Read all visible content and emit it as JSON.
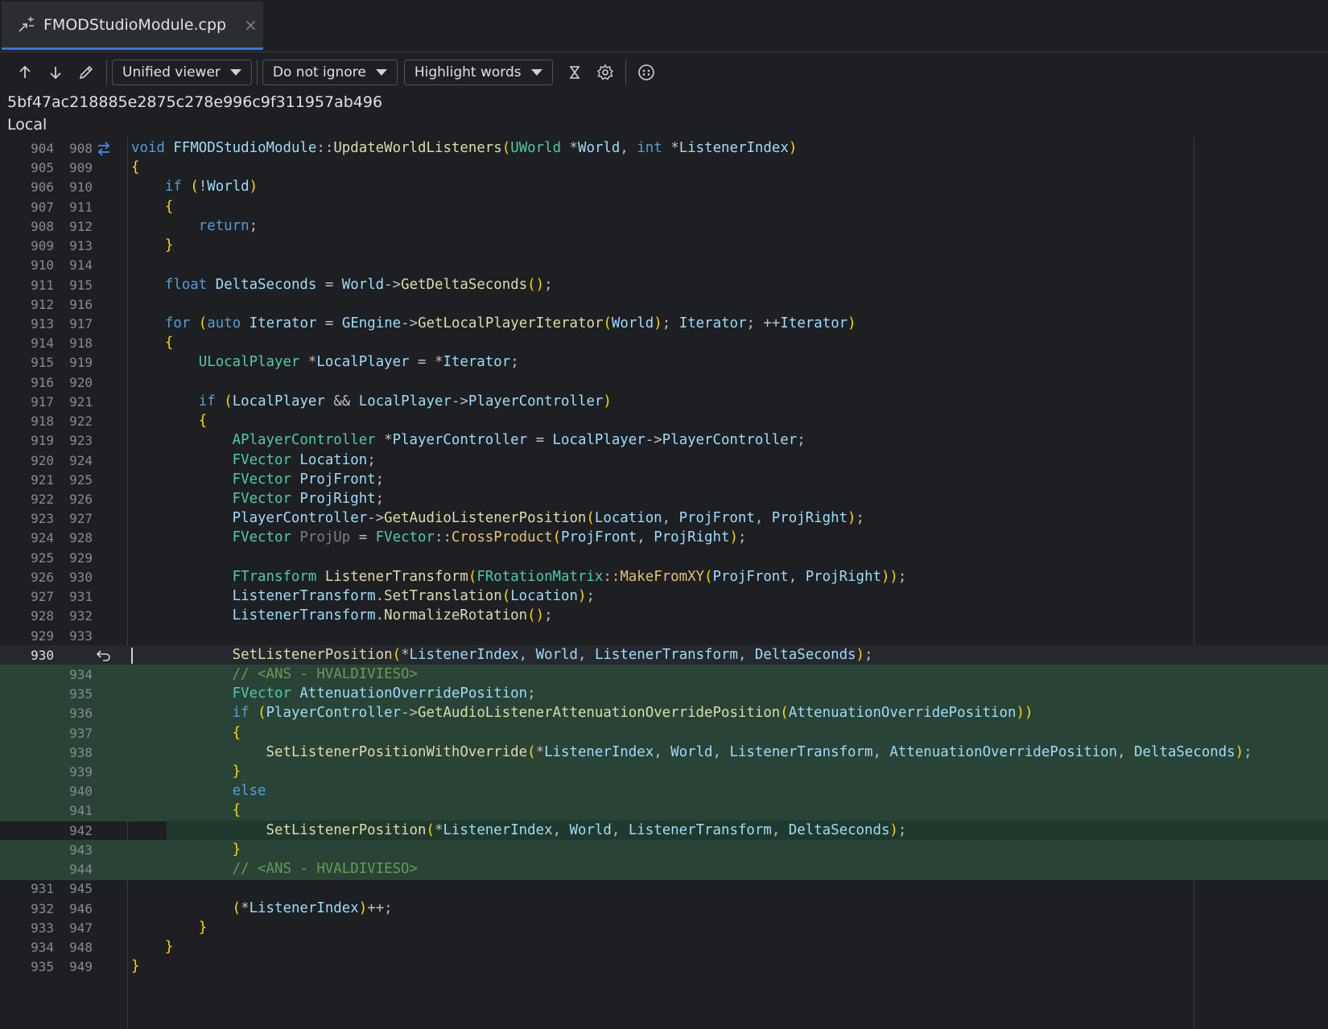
{
  "tab": {
    "filename": "FMODStudioModule.cpp",
    "close_glyph": "×"
  },
  "toolbar": {
    "viewer_mode": "Unified viewer",
    "ignore_mode": "Do not ignore",
    "highlight_mode": "Highlight words"
  },
  "info": {
    "commit_hash": "5bf47ac218885e2875c278e996c9f311957ab496",
    "side_label": "Local"
  },
  "lines": [
    {
      "l": "904",
      "r": "908",
      "t": "void FFMODStudioModule::UpdateWorldListeners(UWorld *World, int *ListenerIndex)"
    },
    {
      "l": "905",
      "r": "909",
      "t": "{"
    },
    {
      "l": "906",
      "r": "910",
      "t": "    if (!World)"
    },
    {
      "l": "907",
      "r": "911",
      "t": "    {"
    },
    {
      "l": "908",
      "r": "912",
      "t": "        return;"
    },
    {
      "l": "909",
      "r": "913",
      "t": "    }"
    },
    {
      "l": "910",
      "r": "914",
      "t": ""
    },
    {
      "l": "911",
      "r": "915",
      "t": "    float DeltaSeconds = World->GetDeltaSeconds();"
    },
    {
      "l": "912",
      "r": "916",
      "t": ""
    },
    {
      "l": "913",
      "r": "917",
      "t": "    for (auto Iterator = GEngine->GetLocalPlayerIterator(World); Iterator; ++Iterator)"
    },
    {
      "l": "914",
      "r": "918",
      "t": "    {"
    },
    {
      "l": "915",
      "r": "919",
      "t": "        ULocalPlayer *LocalPlayer = *Iterator;"
    },
    {
      "l": "916",
      "r": "920",
      "t": ""
    },
    {
      "l": "917",
      "r": "921",
      "t": "        if (LocalPlayer && LocalPlayer->PlayerController)"
    },
    {
      "l": "918",
      "r": "922",
      "t": "        {"
    },
    {
      "l": "919",
      "r": "923",
      "t": "            APlayerController *PlayerController = LocalPlayer->PlayerController;"
    },
    {
      "l": "920",
      "r": "924",
      "t": "            FVector Location;"
    },
    {
      "l": "921",
      "r": "925",
      "t": "            FVector ProjFront;"
    },
    {
      "l": "922",
      "r": "926",
      "t": "            FVector ProjRight;"
    },
    {
      "l": "923",
      "r": "927",
      "t": "            PlayerController->GetAudioListenerPosition(Location, ProjFront, ProjRight);"
    },
    {
      "l": "924",
      "r": "928",
      "t": "            FVector ProjUp = FVector::CrossProduct(ProjFront, ProjRight);"
    },
    {
      "l": "925",
      "r": "929",
      "t": ""
    },
    {
      "l": "926",
      "r": "930",
      "t": "            FTransform ListenerTransform(FRotationMatrix::MakeFromXY(ProjFront, ProjRight));"
    },
    {
      "l": "927",
      "r": "931",
      "t": "            ListenerTransform.SetTranslation(Location);"
    },
    {
      "l": "928",
      "r": "932",
      "t": "            ListenerTransform.NormalizeRotation();"
    },
    {
      "l": "929",
      "r": "933",
      "t": ""
    },
    {
      "l": "930",
      "r": "",
      "t": "            SetListenerPosition(*ListenerIndex, World, ListenerTransform, DeltaSeconds);"
    },
    {
      "l": "",
      "r": "934",
      "t": "            // <ANS - HVALDIVIESO>"
    },
    {
      "l": "",
      "r": "935",
      "t": "            FVector AttenuationOverridePosition;"
    },
    {
      "l": "",
      "r": "936",
      "t": "            if (PlayerController->GetAudioListenerAttenuationOverridePosition(AttenuationOverridePosition))"
    },
    {
      "l": "",
      "r": "937",
      "t": "            {"
    },
    {
      "l": "",
      "r": "938",
      "t": "                SetListenerPositionWithOverride(*ListenerIndex, World, ListenerTransform, AttenuationOverridePosition, DeltaSeconds);"
    },
    {
      "l": "",
      "r": "939",
      "t": "            }"
    },
    {
      "l": "",
      "r": "940",
      "t": "            else"
    },
    {
      "l": "",
      "r": "941",
      "t": "            {"
    },
    {
      "l": "",
      "r": "942",
      "t": "                SetListenerPosition(*ListenerIndex, World, ListenerTransform, DeltaSeconds);"
    },
    {
      "l": "",
      "r": "943",
      "t": "            }"
    },
    {
      "l": "",
      "r": "944",
      "t": "            // <ANS - HVALDIVIESO>"
    },
    {
      "l": "931",
      "r": "945",
      "t": ""
    },
    {
      "l": "932",
      "r": "946",
      "t": "            (*ListenerIndex)++;"
    },
    {
      "l": "933",
      "r": "947",
      "t": "        }"
    },
    {
      "l": "934",
      "r": "948",
      "t": "    }"
    },
    {
      "l": "935",
      "r": "949",
      "t": "}"
    }
  ],
  "colors": {
    "accent": "#3574f0",
    "added_bg": "#294436",
    "background": "#1e1f22"
  }
}
